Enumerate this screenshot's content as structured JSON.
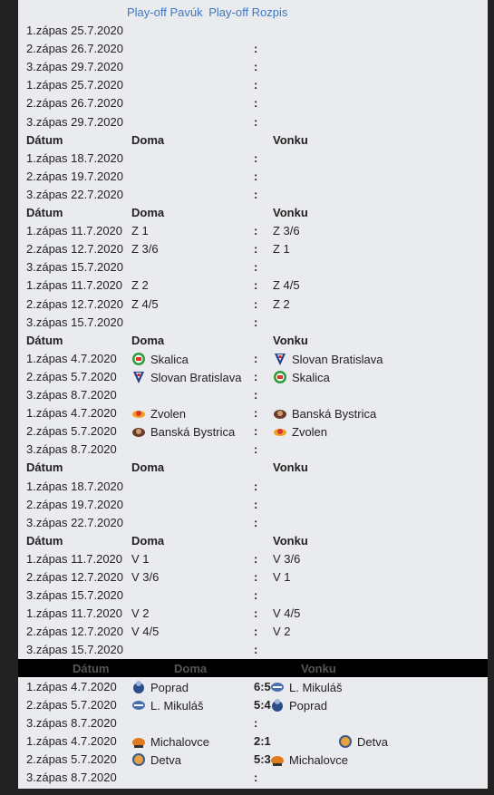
{
  "tabs": [
    "Play-off Pavúk",
    "Play-off Rozpis"
  ],
  "headers": {
    "date": "Dátum",
    "home": "Doma",
    "away": "Vonku"
  },
  "rows": [
    {
      "date": "1.zápas 25.7.2020",
      "colon": ""
    },
    {
      "date": "2.zápas 26.7.2020",
      "colon": ":"
    },
    {
      "date": "3.zápas 29.7.2020",
      "colon": ":"
    },
    {
      "date": "1.zápas 25.7.2020",
      "colon": ":"
    },
    {
      "date": "2.zápas 26.7.2020",
      "colon": ":"
    },
    {
      "date": "3.zápas 29.7.2020",
      "colon": ":"
    },
    {
      "header": true
    },
    {
      "date": "1.zápas 18.7.2020",
      "colon": ":"
    },
    {
      "date": "2.zápas 19.7.2020",
      "colon": ":"
    },
    {
      "date": "3.zápas 22.7.2020",
      "colon": ":"
    },
    {
      "header": true
    },
    {
      "date": "1.zápas 11.7.2020",
      "home": "Z 1",
      "colon": ":",
      "away": "Z 3/6"
    },
    {
      "date": "2.zápas 12.7.2020",
      "home": "Z 3/6",
      "colon": ":",
      "away": "Z 1"
    },
    {
      "date": "3.zápas 15.7.2020",
      "colon": ":"
    },
    {
      "date": "1.zápas 11.7.2020",
      "home": "Z 2",
      "colon": ":",
      "away": "Z 4/5"
    },
    {
      "date": "2.zápas 12.7.2020",
      "home": "Z 4/5",
      "colon": ":",
      "away": "Z 2"
    },
    {
      "date": "3.zápas 15.7.2020",
      "colon": ":"
    },
    {
      "header": true
    },
    {
      "date": "1.zápas 4.7.2020",
      "home": "Skalica",
      "home_logo": "skalica",
      "colon": ":",
      "away": "Slovan Bratislava",
      "away_logo": "slovan"
    },
    {
      "date": "2.zápas 5.7.2020",
      "home": "Slovan Bratislava",
      "home_logo": "slovan",
      "colon": ":",
      "away": "Skalica",
      "away_logo": "skalica"
    },
    {
      "date": "3.zápas 8.7.2020",
      "colon": ":"
    },
    {
      "date": "1.zápas 4.7.2020",
      "home": "Zvolen",
      "home_logo": "zvolen",
      "colon": ":",
      "away": "Banská Bystrica",
      "away_logo": "bystrica"
    },
    {
      "date": "2.zápas 5.7.2020",
      "home": "Banská Bystrica",
      "home_logo": "bystrica",
      "colon": ":",
      "away": "Zvolen",
      "away_logo": "zvolen"
    },
    {
      "date": "3.zápas 8.7.2020",
      "colon": ":"
    },
    {
      "header": true
    },
    {
      "date": "1.zápas 18.7.2020",
      "colon": ":"
    },
    {
      "date": "2.zápas 19.7.2020",
      "colon": ":"
    },
    {
      "date": "3.zápas 22.7.2020",
      "colon": ":"
    },
    {
      "header": true
    },
    {
      "date": "1.zápas 11.7.2020",
      "home": "V 1",
      "colon": ":",
      "away": "V 3/6"
    },
    {
      "date": "2.zápas 12.7.2020",
      "home": "V 3/6",
      "colon": ":",
      "away": "V 1"
    },
    {
      "date": "3.zápas 15.7.2020",
      "colon": ":"
    },
    {
      "date": "1.zápas 11.7.2020",
      "home": "V 2",
      "colon": ":",
      "away": "V 4/5"
    },
    {
      "date": "2.zápas 12.7.2020",
      "home": "V 4/5",
      "colon": ":",
      "away": "V 2"
    },
    {
      "date": "3.zápas 15.7.2020",
      "colon": ":"
    },
    {
      "header": true,
      "black": true
    },
    {
      "date": "1.zápas 4.7.2020",
      "home": "Poprad",
      "home_logo": "poprad",
      "colon": "6:5",
      "away": "L. Mikuláš",
      "away_logo": "mikulas"
    },
    {
      "date": "2.zápas 5.7.2020",
      "home": "L. Mikuláš",
      "home_logo": "mikulas",
      "colon": "5:4",
      "away": "Poprad",
      "away_logo": "poprad"
    },
    {
      "date": "3.zápas 8.7.2020",
      "colon": ":"
    },
    {
      "date": "1.zápas 4.7.2020",
      "home": "Michalovce",
      "home_logo": "michalovce",
      "colon": "2:1",
      "away": "Detva",
      "away_logo": "detva",
      "away_wide": true
    },
    {
      "date": "2.zápas 5.7.2020",
      "home": "Detva",
      "home_logo": "detva",
      "colon": "5:3",
      "away": "Michalovce",
      "away_logo": "michalovce"
    },
    {
      "date": "3.zápas 8.7.2020",
      "colon": ":"
    }
  ]
}
